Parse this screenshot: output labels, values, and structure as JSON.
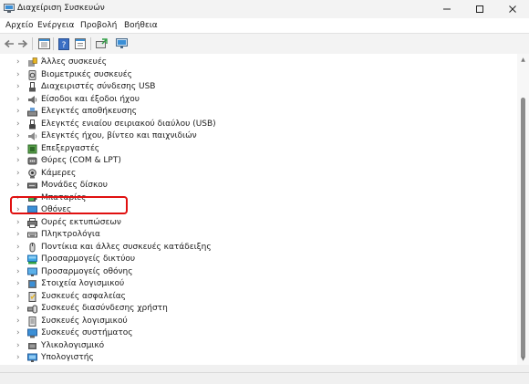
{
  "window": {
    "title": "Διαχείριση Συσκευών"
  },
  "menu": [
    "Αρχείο",
    "Ενέργεια",
    "Προβολή",
    "Βοήθεια"
  ],
  "tree": [
    {
      "label": "Άλλες συσκευές",
      "icon": "other-devices-icon"
    },
    {
      "label": "Βιομετρικές συσκευές",
      "icon": "biometric-icon"
    },
    {
      "label": "Διαχειριστές σύνδεσης USB",
      "icon": "usb-icon"
    },
    {
      "label": "Είσοδοι και έξοδοι ήχου",
      "icon": "speaker-icon"
    },
    {
      "label": "Ελεγκτές αποθήκευσης",
      "icon": "storage-controller-icon"
    },
    {
      "label": "Ελεγκτές ενιαίου σειριακού διαύλου (USB)",
      "icon": "usb-controller-icon"
    },
    {
      "label": "Ελεγκτές ήχου, βίντεο και παιχνιδιών",
      "icon": "sound-video-icon"
    },
    {
      "label": "Επεξεργαστές",
      "icon": "processor-icon"
    },
    {
      "label": "Θύρες (COM & LPT)",
      "icon": "port-icon"
    },
    {
      "label": "Κάμερες",
      "icon": "camera-icon"
    },
    {
      "label": "Μονάδες δίσκου",
      "icon": "disk-drive-icon"
    },
    {
      "label": "Μπαταρίες",
      "icon": "battery-icon"
    },
    {
      "label": "Οθόνες",
      "icon": "monitor-icon"
    },
    {
      "label": "Ουρές εκτυπώσεων",
      "icon": "printer-icon"
    },
    {
      "label": "Πληκτρολόγια",
      "icon": "keyboard-icon"
    },
    {
      "label": "Ποντίκια και άλλες συσκευές κατάδειξης",
      "icon": "mouse-icon"
    },
    {
      "label": "Προσαρμογείς δικτύου",
      "icon": "network-adapter-icon"
    },
    {
      "label": "Προσαρμογείς οθόνης",
      "icon": "display-adapter-icon"
    },
    {
      "label": "Στοιχεία λογισμικού",
      "icon": "software-component-icon"
    },
    {
      "label": "Συσκευές ασφαλείας",
      "icon": "security-device-icon"
    },
    {
      "label": "Συσκευές διασύνδεσης χρήστη",
      "icon": "hid-icon"
    },
    {
      "label": "Συσκευές λογισμικού",
      "icon": "software-device-icon"
    },
    {
      "label": "Συσκευές συστήματος",
      "icon": "system-device-icon"
    },
    {
      "label": "Υλικολογισμικό",
      "icon": "firmware-icon"
    },
    {
      "label": "Υπολογιστής",
      "icon": "computer-icon"
    }
  ],
  "highlighted_item": "Προσαρμογείς δικτύου",
  "colors": {
    "highlight": "#e01010",
    "accent": "#1e88d8"
  }
}
